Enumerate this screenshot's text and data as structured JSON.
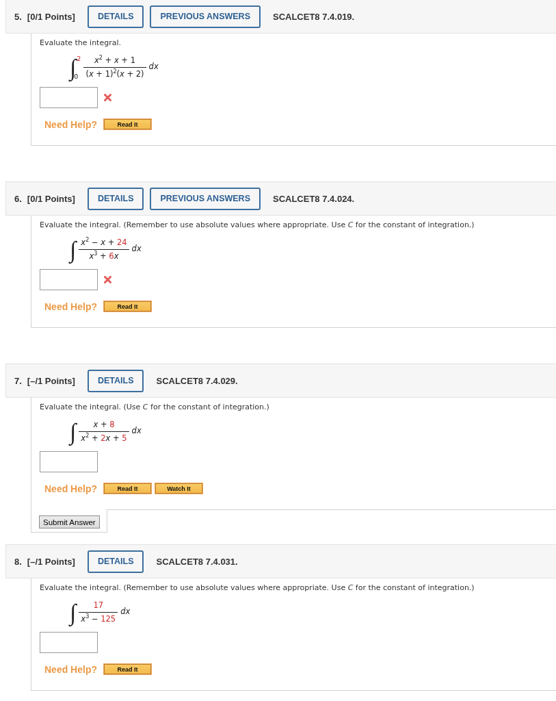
{
  "questions": [
    {
      "number": "5.",
      "points": "[0/1 Points]",
      "details_button": "DETAILS",
      "previous_answers_button": "PREVIOUS ANSWERS",
      "code": "SCALCET8 7.4.019.",
      "prompt": "Evaluate the integral.",
      "integral": {
        "symbol": "∫",
        "upper": [
          {
            "kind": "param",
            "text": "2"
          }
        ],
        "lower": [
          {
            "kind": "plain",
            "text": "0"
          }
        ],
        "numerator": [
          {
            "kind": "plain",
            "text": "*x*$^{2}$ + *x* + 1"
          }
        ],
        "denominator": [
          {
            "kind": "plain",
            "text": "(*x* + 1)$^{2}$(*x* + 2)"
          }
        ],
        "differential": "dx"
      },
      "answer_incorrect": true,
      "need_help": "Need Help?",
      "read_it_button": "Read It"
    },
    {
      "number": "6.",
      "points": "[0/1 Points]",
      "details_button": "DETAILS",
      "previous_answers_button": "PREVIOUS ANSWERS",
      "code": "SCALCET8 7.4.024.",
      "prompt": "Evaluate the integral. (Remember to use absolute values where appropriate. Use *C* for the constant of integration.)",
      "integral": {
        "symbol": "∫",
        "numerator": [
          {
            "kind": "plain",
            "text": "*x*$^{2}$ − *x* + "
          },
          {
            "kind": "param",
            "text": "24"
          }
        ],
        "denominator": [
          {
            "kind": "plain",
            "text": "*x*$^{3}$ + "
          },
          {
            "kind": "param",
            "text": "6"
          },
          {
            "kind": "plain",
            "text": "*x*"
          }
        ],
        "differential": "dx"
      },
      "answer_incorrect": true,
      "need_help": "Need Help?",
      "read_it_button": "Read It"
    },
    {
      "number": "7.",
      "points": "[–/1 Points]",
      "details_button": "DETAILS",
      "code": "SCALCET8 7.4.029.",
      "prompt": "Evaluate the integral. (Use *C* for the constant of integration.)",
      "integral": {
        "symbol": "∫",
        "numerator": [
          {
            "kind": "plain",
            "text": "*x* + "
          },
          {
            "kind": "param",
            "text": "8"
          }
        ],
        "denominator": [
          {
            "kind": "plain",
            "text": "*x*$^{2}$ + "
          },
          {
            "kind": "param",
            "text": "2"
          },
          {
            "kind": "plain",
            "text": "*x* + "
          },
          {
            "kind": "param",
            "text": "5"
          }
        ],
        "differential": "dx"
      },
      "answer_incorrect": false,
      "need_help": "Need Help?",
      "read_it_button": "Read It",
      "watch_it_button": "Watch It",
      "submit_button": "Submit Answer"
    },
    {
      "number": "8.",
      "points": "[–/1 Points]",
      "details_button": "DETAILS",
      "code": "SCALCET8 7.4.031.",
      "prompt": "Evaluate the integral. (Remember to use absolute values where appropriate. Use *C* for the constant of integration.)",
      "integral": {
        "symbol": "∫",
        "numerator": [
          {
            "kind": "param",
            "text": "17"
          }
        ],
        "denominator": [
          {
            "kind": "plain",
            "text": "*x*$^{3}$ − "
          },
          {
            "kind": "param",
            "text": "125"
          }
        ],
        "differential": "dx"
      },
      "answer_incorrect": false,
      "need_help": "Need Help?",
      "read_it_button": "Read It"
    }
  ]
}
